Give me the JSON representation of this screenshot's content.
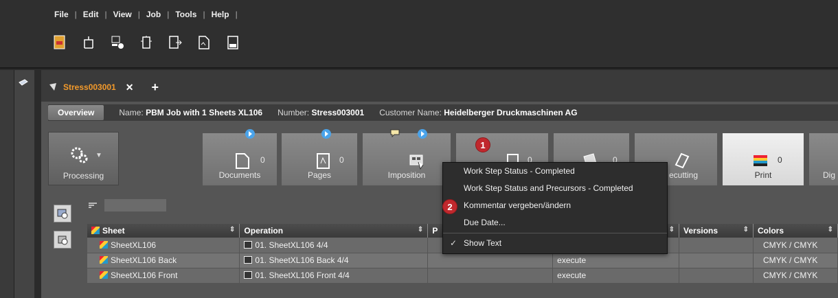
{
  "menubar": {
    "items": [
      "File",
      "Edit",
      "View",
      "Job",
      "Tools",
      "Help"
    ]
  },
  "toolbar": {
    "icons": [
      "job-report-icon",
      "job-tree-icon",
      "user-settings-icon",
      "device-icon",
      "import-icon",
      "document-icon",
      "ppd-icon"
    ]
  },
  "job_tab": {
    "name": "Stress003001",
    "close": "✕",
    "add": "+"
  },
  "infobar": {
    "overview_label": "Overview",
    "name_label": "Name:",
    "name_value": "PBM Job with 1 Sheets XL106",
    "number_label": "Number:",
    "number_value": "Stress003001",
    "customer_label": "Customer Name:",
    "customer_value": "Heidelberger Druckmaschinen AG"
  },
  "workflow": {
    "processing_label": "Processing",
    "steps": [
      {
        "label": "Documents",
        "count": "0"
      },
      {
        "label": "Pages",
        "count": "0"
      },
      {
        "label": "Imposition",
        "count": ""
      },
      {
        "label": "",
        "count": "0"
      },
      {
        "label": "",
        "count": "0"
      },
      {
        "label": "ecutting",
        "count": ""
      },
      {
        "label": "Print",
        "count": "0"
      },
      {
        "label": "Dig",
        "count": ""
      }
    ]
  },
  "markers": {
    "first": "1",
    "second": "2"
  },
  "context_menu": {
    "items": [
      "Work Step Status - Completed",
      "Work Step Status and Precursors - Completed",
      "Kommentar vergeben/ändern",
      "Due Date...",
      "Show Text"
    ],
    "checked_index": 4
  },
  "table": {
    "headers": [
      "Sheet",
      "Operation",
      "P",
      "",
      "Versions",
      "Colors"
    ],
    "rows": [
      {
        "sheet": "SheetXL106",
        "operation": "01. SheetXL106 4/4",
        "status": "",
        "colors": "CMYK / CMYK"
      },
      {
        "sheet": "SheetXL106 Back",
        "operation": "01. SheetXL106 Back 4/4",
        "status": "execute",
        "colors": "CMYK / CMYK"
      },
      {
        "sheet": "SheetXL106 Front",
        "operation": "01. SheetXL106 Front 4/4",
        "status": "execute",
        "colors": "CMYK / CMYK"
      }
    ]
  },
  "colors": {
    "accent_orange": "#f39a2b",
    "marker_red": "#c0282d",
    "play_blue": "#4aa3ea"
  }
}
